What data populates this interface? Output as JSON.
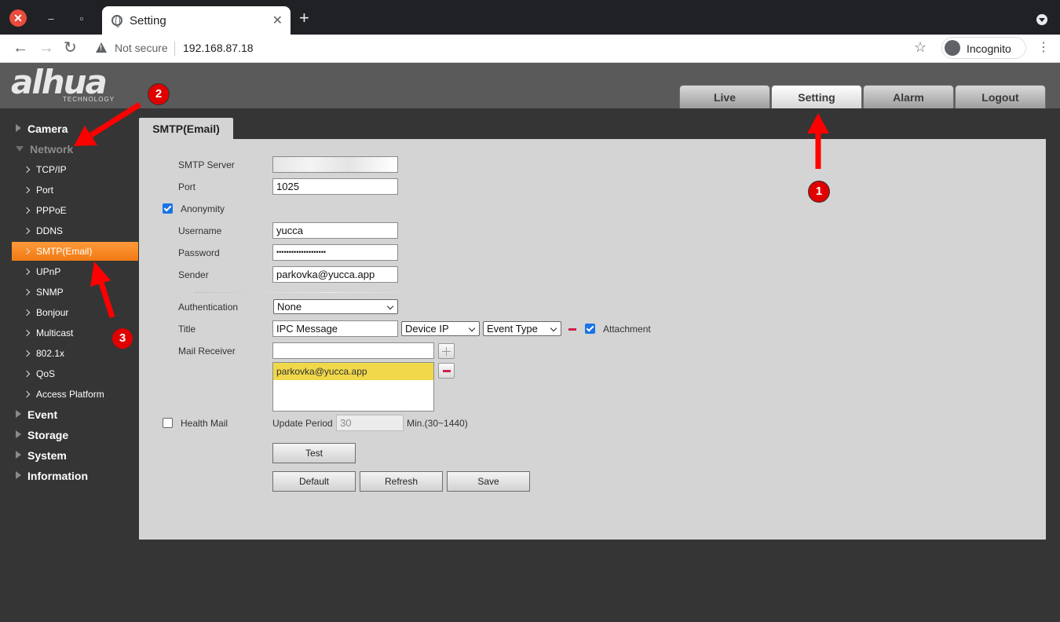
{
  "browser": {
    "tab_title": "Setting",
    "security_label": "Not secure",
    "url": "192.168.87.18",
    "incognito_label": "Incognito",
    "close_tab_glyph": "✕",
    "new_tab_glyph": "+"
  },
  "header": {
    "logo_text": "alhua",
    "logo_subtitle": "TECHNOLOGY",
    "tabs": [
      {
        "label": "Live"
      },
      {
        "label": "Setting"
      },
      {
        "label": "Alarm"
      },
      {
        "label": "Logout"
      }
    ],
    "active_tab": "Setting"
  },
  "sidebar": {
    "sections": [
      {
        "label": "Camera"
      },
      {
        "label": "Network"
      },
      {
        "label": "Event"
      },
      {
        "label": "Storage"
      },
      {
        "label": "System"
      },
      {
        "label": "Information"
      }
    ],
    "network_items": [
      {
        "label": "TCP/IP"
      },
      {
        "label": "Port"
      },
      {
        "label": "PPPoE"
      },
      {
        "label": "DDNS"
      },
      {
        "label": "SMTP(Email)"
      },
      {
        "label": "UPnP"
      },
      {
        "label": "SNMP"
      },
      {
        "label": "Bonjour"
      },
      {
        "label": "Multicast"
      },
      {
        "label": "802.1x"
      },
      {
        "label": "QoS"
      },
      {
        "label": "Access Platform"
      }
    ],
    "active_item": "SMTP(Email)"
  },
  "content": {
    "tab_label": "SMTP(Email)",
    "form": {
      "smtp_server_label": "SMTP Server",
      "smtp_server_value": "",
      "port_label": "Port",
      "port_value": "1025",
      "anonymity_label": "Anonymity",
      "anonymity_checked": true,
      "username_label": "Username",
      "username_value": "yucca",
      "password_label": "Password",
      "password_value": "••••••••••••••••••••",
      "sender_label": "Sender",
      "sender_value": "parkovka@yucca.app",
      "authentication_label": "Authentication",
      "authentication_value": "None",
      "title_label": "Title",
      "title_value": "IPC Message",
      "title_select_1": "Device IP",
      "title_select_2": "Event Type",
      "attachment_label": "Attachment",
      "attachment_checked": true,
      "mail_receiver_label": "Mail Receiver",
      "mail_receiver_input": "",
      "receivers": [
        "parkovka@yucca.app"
      ],
      "health_mail_label": "Health Mail",
      "health_mail_checked": false,
      "update_period_label": "Update Period",
      "update_period_value": "30",
      "update_period_unit": "Min.(30~1440)"
    },
    "buttons": {
      "test": "Test",
      "default": "Default",
      "refresh": "Refresh",
      "save": "Save"
    }
  },
  "annotations": {
    "badges": [
      "1",
      "2",
      "3"
    ],
    "color": "#e00000"
  }
}
